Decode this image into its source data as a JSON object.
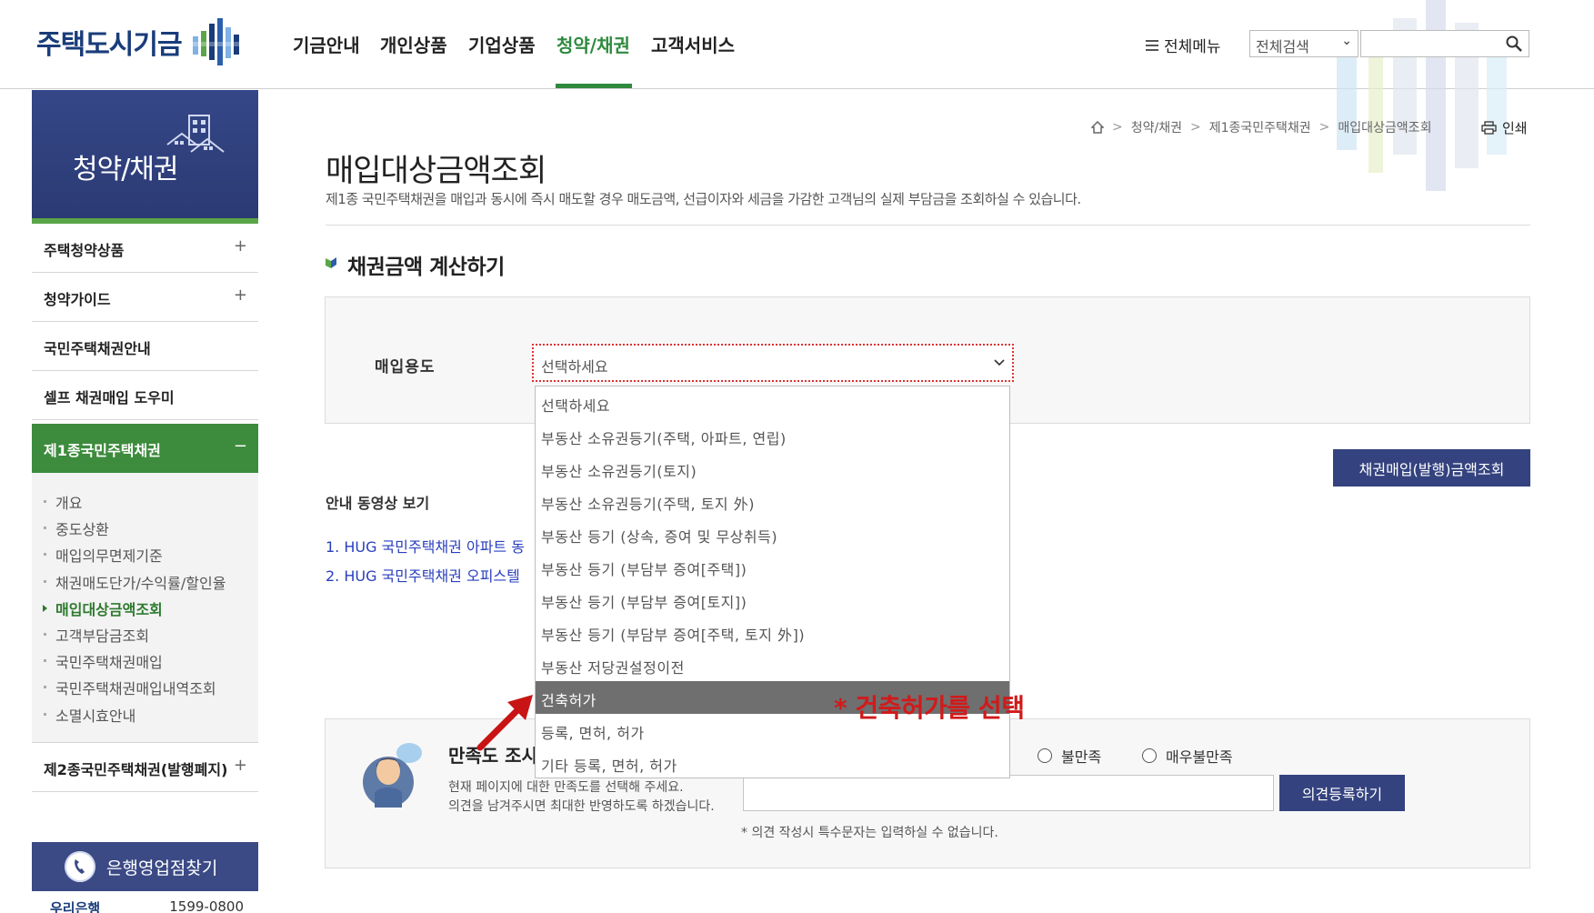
{
  "header": {
    "logo": "주택도시기금",
    "nav": [
      "기금안내",
      "개인상품",
      "기업상품",
      "청약/채권",
      "고객서비스"
    ],
    "active_nav": "청약/채권",
    "all_menu": "전체메뉴",
    "search_scope": "전체검색",
    "search_placeholder": "",
    "colors": {
      "brand": "#1a3c7a",
      "accent": "#2e8a3e"
    }
  },
  "sidebar": {
    "title": "청약/채권",
    "items": [
      {
        "label": "주택청약상품",
        "toggle": "+"
      },
      {
        "label": "청약가이드",
        "toggle": "+"
      },
      {
        "label": "국민주택채권안내",
        "toggle": ""
      },
      {
        "label": "셀프 채권매입 도우미",
        "toggle": ""
      },
      {
        "label": "제1종국민주택채권",
        "toggle": "−"
      }
    ],
    "sub_items": [
      "개요",
      "중도상환",
      "매입의무면제기준",
      "채권매도단가/수익률/할인율",
      "매입대상금액조회",
      "고객부담금조회",
      "국민주택채권매입",
      "국민주택채권매입내역조회",
      "소멸시효안내"
    ],
    "active_sub": "매입대상금액조회",
    "last_item": {
      "label": "제2종국민주택채권(발행폐지)",
      "toggle": "+"
    },
    "bank_finder": "은행영업점찾기",
    "bank_name": "우리은행",
    "bank_phone": "1599-0800"
  },
  "breadcrumb": [
    "청약/채권",
    "제1종국민주택채권",
    "매입대상금액조회"
  ],
  "print_label": "인쇄",
  "page": {
    "title": "매입대상금액조회",
    "description": "제1종 국민주택채권을 매입과 동시에 즉시 매도할 경우 매도금액, 선급이자와 세금을 가감한 고객님의 실제 부담금을 조회하실 수 있습니다.",
    "section_title": "채권금액 계산하기"
  },
  "form": {
    "label": "매입용도",
    "selected": "선택하세요",
    "options": [
      "선택하세요",
      "부동산 소유권등기(주택, 아파트, 연립)",
      "부동산 소유권등기(토지)",
      "부동산 소유권등기(주택, 토지 外)",
      "부동산 등기 (상속, 증여 및 무상취득)",
      "부동산 등기 (부담부 증여[주택])",
      "부동산 등기 (부담부 증여[토지])",
      "부동산 등기 (부담부 증여[주택, 토지 外])",
      "부동산 저당권설정이전",
      "건축허가",
      "등록, 면허, 허가",
      "기타 등록, 면허, 허가"
    ],
    "highlighted_option": "건축허가",
    "calc_button": "채권매입(발행)금액조회"
  },
  "video": {
    "title": "안내 동영상 보기",
    "links": [
      "1. HUG 국민주택채권 아파트 동",
      "2. HUG 국민주택채권 오피스텔"
    ]
  },
  "survey": {
    "title": "만족도 조사",
    "desc1": "현재 페이지에 대한 만족도를 선택해 주세요.",
    "desc2": "의견을 남겨주시면 최대한 반영하도록 하겠습니다.",
    "options": [
      "불만족",
      "매우불만족"
    ],
    "opinion_button": "의견등록하기",
    "note": "* 의견 작성시 특수문자는 입력하실 수 없습니다."
  },
  "annotation": "* 건축허가를 선택"
}
